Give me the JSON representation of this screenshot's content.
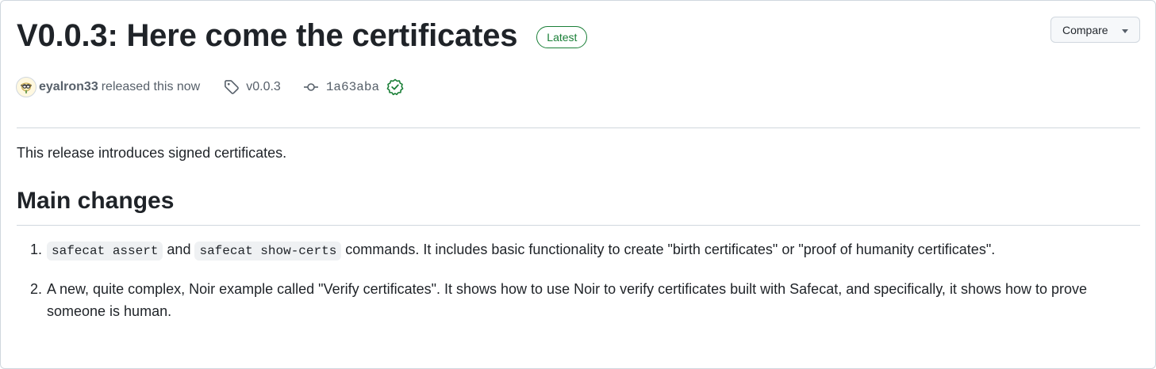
{
  "release": {
    "title": "V0.0.3: Here come the certificates",
    "badge": "Latest",
    "compare_label": "Compare",
    "author": "eyalron33",
    "released_text": "released this now",
    "tag": "v0.0.3",
    "commit": "1a63aba"
  },
  "body": {
    "intro": "This release introduces signed certificates.",
    "heading": "Main changes",
    "items": [
      {
        "number": "1.",
        "code1": "safecat assert",
        "text1": " and ",
        "code2": "safecat show-certs",
        "text2": " commands. It includes basic functionality to create \"birth certificates\" or \"proof of humanity certificates\"."
      },
      {
        "number": "2.",
        "text": "A new, quite complex, Noir example called \"Verify certificates\". It shows how to use Noir to verify certificates built with Safecat, and specifically, it shows how to prove someone is human."
      }
    ]
  },
  "icons": {
    "tag": "tag-icon",
    "commit": "git-commit-icon",
    "verified": "verified-check-icon",
    "caret": "triangle-down-icon"
  },
  "colors": {
    "latest_badge": "#1a7f37",
    "verified": "#1a7f37",
    "muted_text": "#57606a",
    "border": "#d0d7de"
  }
}
